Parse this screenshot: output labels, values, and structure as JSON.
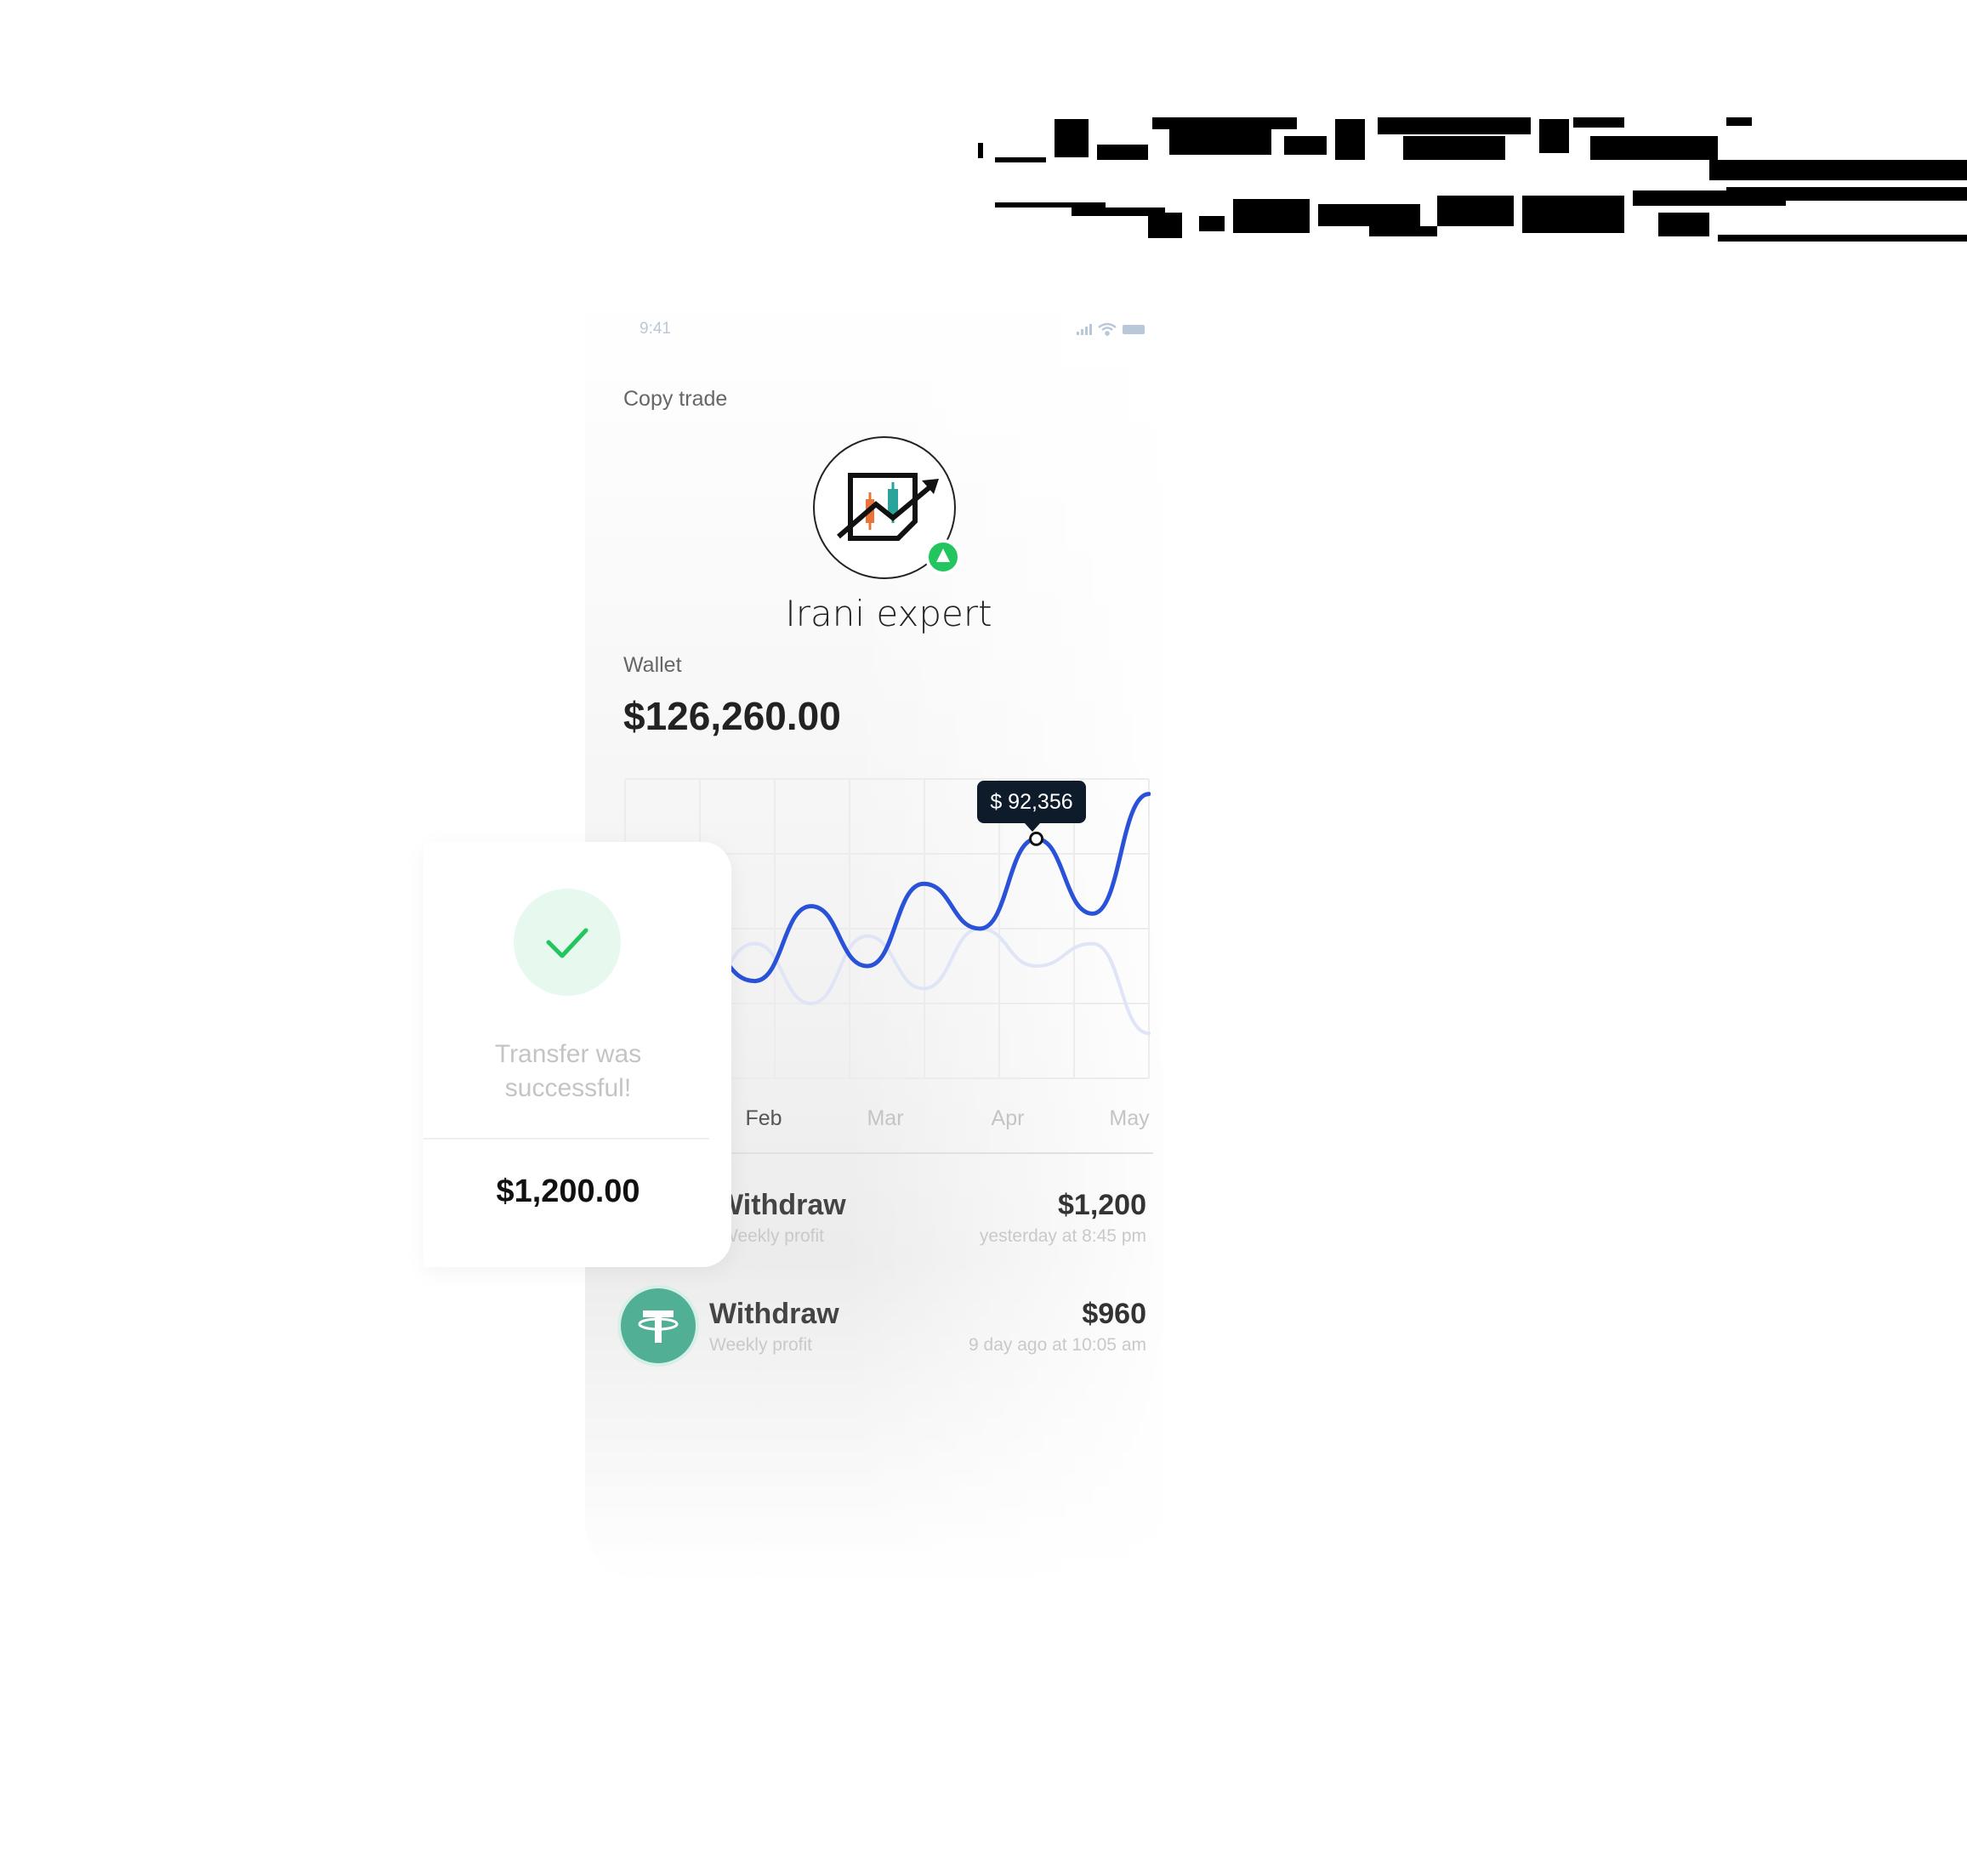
{
  "status": {
    "time": "9:41"
  },
  "screen": {
    "title": "Copy trade"
  },
  "expert": {
    "name": "Irani expert"
  },
  "wallet": {
    "label": "Wallet",
    "value": "$126,260.00"
  },
  "tooltip": {
    "value": "$ 92,356"
  },
  "chart_data": {
    "type": "line",
    "x": [
      "Feb",
      "Mar",
      "Apr",
      "May"
    ],
    "tick_labels": [
      "Feb",
      "Mar",
      "Apr",
      "May"
    ],
    "tooltip_label": "$ 92,356",
    "grid": true,
    "series": [
      {
        "values": [
          20,
          36,
          26,
          46,
          30,
          52,
          40,
          64,
          44,
          76
        ]
      },
      {
        "values": [
          38,
          22,
          36,
          20,
          38,
          24,
          40,
          30,
          36,
          12
        ]
      }
    ],
    "ylim": [
      0,
      80
    ],
    "colors": [
      "#2952d9",
      "#dfe4f7"
    ]
  },
  "transactions": [
    {
      "title": "Withdraw",
      "subtitle": "Weekly profit",
      "amount": "$1,200",
      "date": "yesterday at 8:45 pm"
    },
    {
      "title": "Withdraw",
      "subtitle": "Weekly profit",
      "amount": "$960",
      "date": "9 day ago at 10:05 am"
    }
  ],
  "transfer_card": {
    "message_line1": "Transfer was",
    "message_line2": "successful!",
    "amount": "$1,200.00"
  },
  "icons": {
    "status": [
      "signal-icon",
      "wifi-icon",
      "battery-icon"
    ],
    "avatar": "candlestick-chart-logo-icon",
    "badge": "online-badge-icon",
    "check": "checkmark-icon",
    "coin": "tether-icon"
  },
  "colors": {
    "accent": "#2952d9",
    "success": "#22c55e",
    "tooltip_bg": "#0d1b2a",
    "tether": "#50af95"
  }
}
